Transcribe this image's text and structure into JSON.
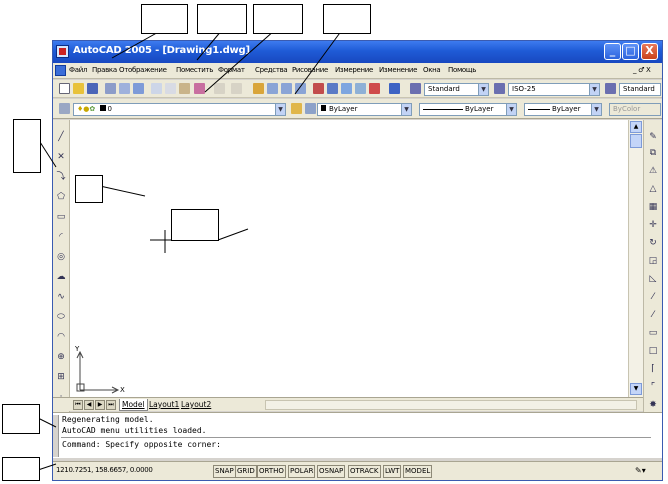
{
  "window": {
    "title": "AutoCAD 2005 - [Drawing1.dwg]",
    "controls": {
      "minimize": "_",
      "maximize": "□",
      "close": "X"
    }
  },
  "menubar": {
    "items": [
      "Файл",
      "Правка",
      "Отображение",
      "Поместить",
      "Формат",
      "Средства",
      "Рисование",
      "Измерение",
      "Изменение",
      "Окна",
      "Помощь"
    ],
    "right": "_ ♂ X"
  },
  "toolbar_standard": {
    "text_style": "Standard",
    "dim_style": "ISO-25",
    "table_style": "Standard"
  },
  "toolbar_properties": {
    "layer": "0",
    "color": "ByLayer",
    "linetype": "ByLayer",
    "lineweight": "ByLayer",
    "plotstyle": "ByColor"
  },
  "drawing": {
    "ucs_x": "X",
    "ucs_y": "Y"
  },
  "tabs": [
    "Model",
    "Layout1",
    "Layout2"
  ],
  "command_window": {
    "lines": [
      "Regenerating model.",
      "AutoCAD menu utilities loaded."
    ],
    "prompt": "Command: Specify opposite corner:"
  },
  "statusbar": {
    "coords": "1210.7251, 158.6657, 0.0000",
    "buttons": [
      "SNAP",
      "GRID",
      "ORTHO",
      "POLAR",
      "OSNAP",
      "OTRACK",
      "LWT",
      "MODEL"
    ]
  },
  "colors": {
    "titlebar": "#1f5bd6",
    "chrome": "#ece9d8",
    "drawing_bg": "#ffffff"
  }
}
